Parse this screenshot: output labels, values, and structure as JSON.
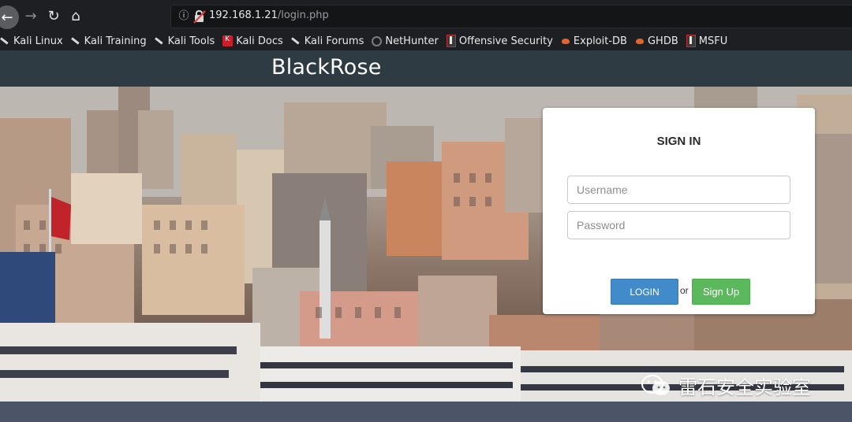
{
  "browser": {
    "url_host": "192.168.1.21",
    "url_path": "/login.php",
    "bookmarks": [
      {
        "label": "Kali Linux",
        "icon": "kali-dragon-icon"
      },
      {
        "label": "Kali Training",
        "icon": "kali-dragon-icon"
      },
      {
        "label": "Kali Tools",
        "icon": "kali-dragon-icon"
      },
      {
        "label": "Kali Docs",
        "icon": "kali-docs-icon"
      },
      {
        "label": "Kali Forums",
        "icon": "kali-dragon-icon"
      },
      {
        "label": "NetHunter",
        "icon": "nethunter-icon"
      },
      {
        "label": "Offensive Security",
        "icon": "offensive-security-icon"
      },
      {
        "label": "Exploit-DB",
        "icon": "exploit-db-icon"
      },
      {
        "label": "GHDB",
        "icon": "exploit-db-icon"
      },
      {
        "label": "MSFU",
        "icon": "offensive-security-icon"
      }
    ]
  },
  "site": {
    "brand": "BlackRose"
  },
  "login": {
    "title": "SIGN IN",
    "username_placeholder": "Username",
    "password_placeholder": "Password",
    "login_label": "LOGIN",
    "or_text": "or",
    "signup_label": "Sign Up"
  },
  "watermark": {
    "text": "雷石安全实验室"
  },
  "colors": {
    "header_bg": "#2f3b42",
    "login_button": "#428bca",
    "signup_button": "#5cb85c"
  }
}
